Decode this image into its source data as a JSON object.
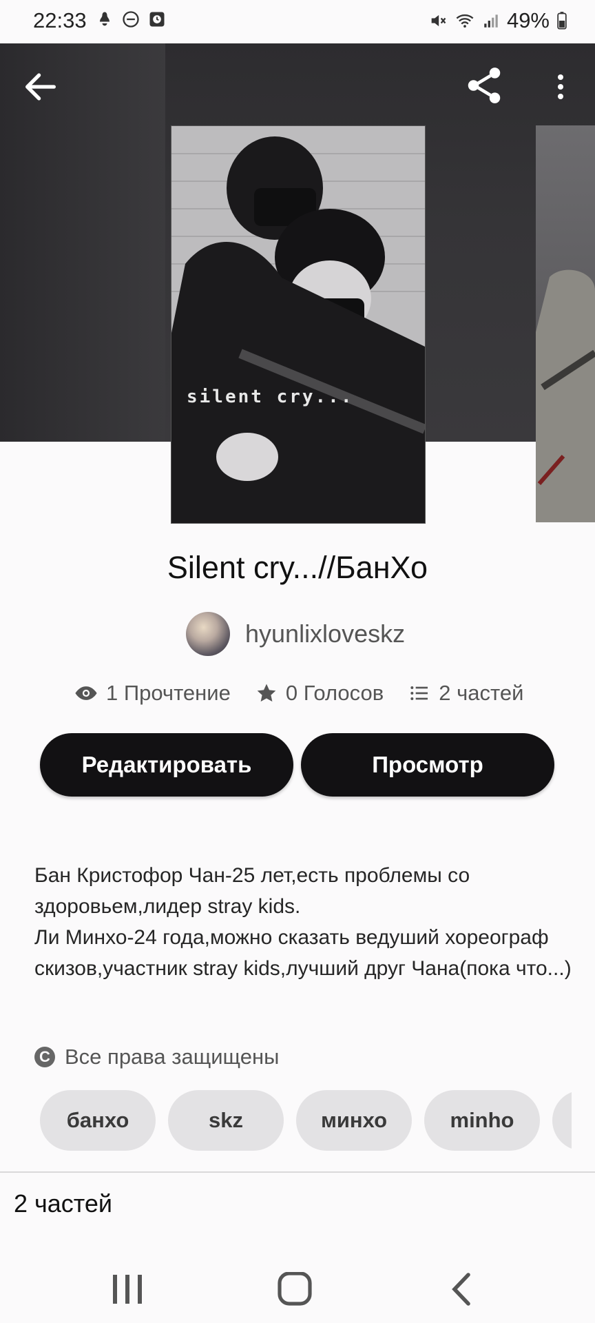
{
  "status_bar": {
    "time": "22:33",
    "battery": "49%",
    "icons": [
      "notification-icon",
      "do-not-disturb-icon",
      "alarm-icon",
      "mute-icon",
      "wifi-icon",
      "signal-icon",
      "battery-icon"
    ]
  },
  "toolbar": {
    "back_icon": "back-arrow-icon",
    "share_icon": "share-icon",
    "more_icon": "more-vertical-icon"
  },
  "cover": {
    "overlay_text": "silent cry..."
  },
  "story": {
    "title": "Silent cry...//БанХо",
    "author": "hyunlixloveskz",
    "stats": {
      "reads": "1 Прочтение",
      "votes": "0 Голосов",
      "parts": "2 частей"
    },
    "description": "Бан Кристофор Чан-25 лет,есть проблемы со здоровьем,лидер stray kids.\nЛи Минхо-24 года,можно сказать ведуший хореограф скизов,участник stray kids,лучший друг Чана(пока что...)",
    "rights": "Все права защищены",
    "rights_icon": "copyright-icon",
    "tags": [
      "банхо",
      "skz",
      "минхо",
      "minho",
      ""
    ]
  },
  "actions": {
    "edit_label": "Редактировать",
    "view_label": "Просмотр"
  },
  "parts_section": {
    "title": "2 частей"
  },
  "nav_bar": {
    "recents_icon": "recents-icon",
    "home_icon": "home-icon",
    "back_icon": "nav-back-icon"
  },
  "colors": {
    "background": "#fbfafb",
    "button": "#121113",
    "tag_bg": "#e3e2e4",
    "hero_bg": "#353437"
  }
}
